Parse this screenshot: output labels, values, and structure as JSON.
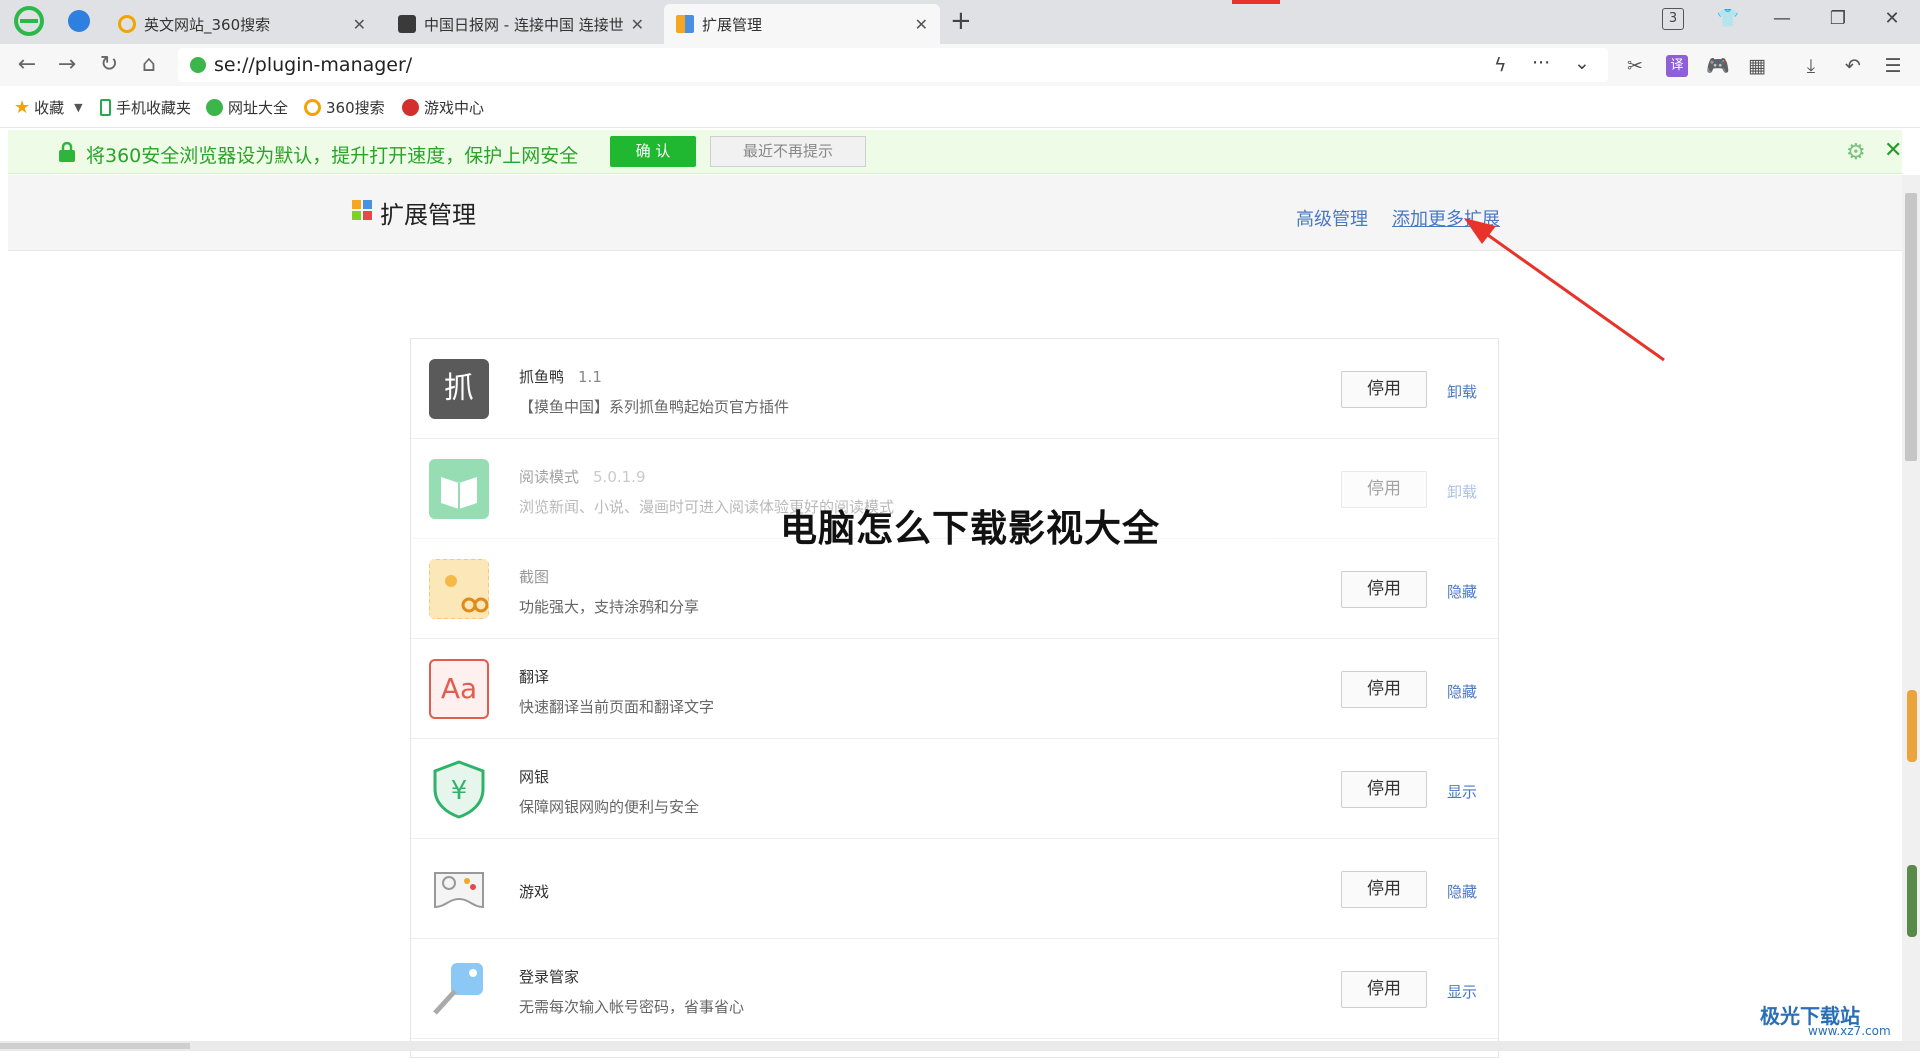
{
  "tabs": [
    {
      "label": "英文网站_360搜索",
      "active": false
    },
    {
      "label": "中国日报网 - 连接中国 连接世界",
      "active": false
    },
    {
      "label": "扩展管理",
      "active": true
    }
  ],
  "tab_count_badge": "3",
  "address": {
    "url": "se://plugin-manager/"
  },
  "bookmarks": [
    "收藏",
    "手机收藏夹",
    "网址大全",
    "360搜索",
    "游戏中心"
  ],
  "notice": {
    "message": "将360安全浏览器设为默认，提升打开速度，保护上网安全",
    "confirm_label": "确 认",
    "later_label": "最近不再提示"
  },
  "page": {
    "title": "扩展管理",
    "advanced_label": "高级管理",
    "add_more_label": "添加更多扩展"
  },
  "extensions": [
    {
      "name": "抓鱼鸭",
      "version": "1.1",
      "desc": "【摸鱼中国】系列抓鱼鸭起始页官方插件",
      "button": "停用",
      "action": "卸载",
      "icon_char": "抓",
      "disabled": false
    },
    {
      "name": "阅读模式",
      "version": "5.0.1.9",
      "desc": "浏览新闻、小说、漫画时可进入阅读体验更好的阅读模式",
      "button": "停用",
      "action": "卸载",
      "disabled": true
    },
    {
      "name": "截图",
      "version": "",
      "desc": "功能强大，支持涂鸦和分享",
      "button": "停用",
      "action": "隐藏",
      "disabled": false
    },
    {
      "name": "翻译",
      "version": "",
      "desc": "快速翻译当前页面和翻译文字",
      "button": "停用",
      "action": "隐藏",
      "icon_char": "Aa",
      "disabled": false
    },
    {
      "name": "网银",
      "version": "",
      "desc": "保障网银网购的便利与安全",
      "button": "停用",
      "action": "显示",
      "icon_char": "¥",
      "disabled": false
    },
    {
      "name": "游戏",
      "version": "",
      "desc": "",
      "button": "停用",
      "action": "隐藏",
      "disabled": false
    },
    {
      "name": "登录管家",
      "version": "",
      "desc": "无需每次输入帐号密码，省事省心",
      "button": "停用",
      "action": "显示",
      "disabled": false
    }
  ],
  "overlay_text": "电脑怎么下载影视大全",
  "watermark": {
    "text": "极光下载站",
    "url": "www.xz7.com"
  },
  "colors": {
    "accent_green": "#21b831",
    "link_blue": "#4b78c2",
    "annotation_red": "#e8332a"
  }
}
